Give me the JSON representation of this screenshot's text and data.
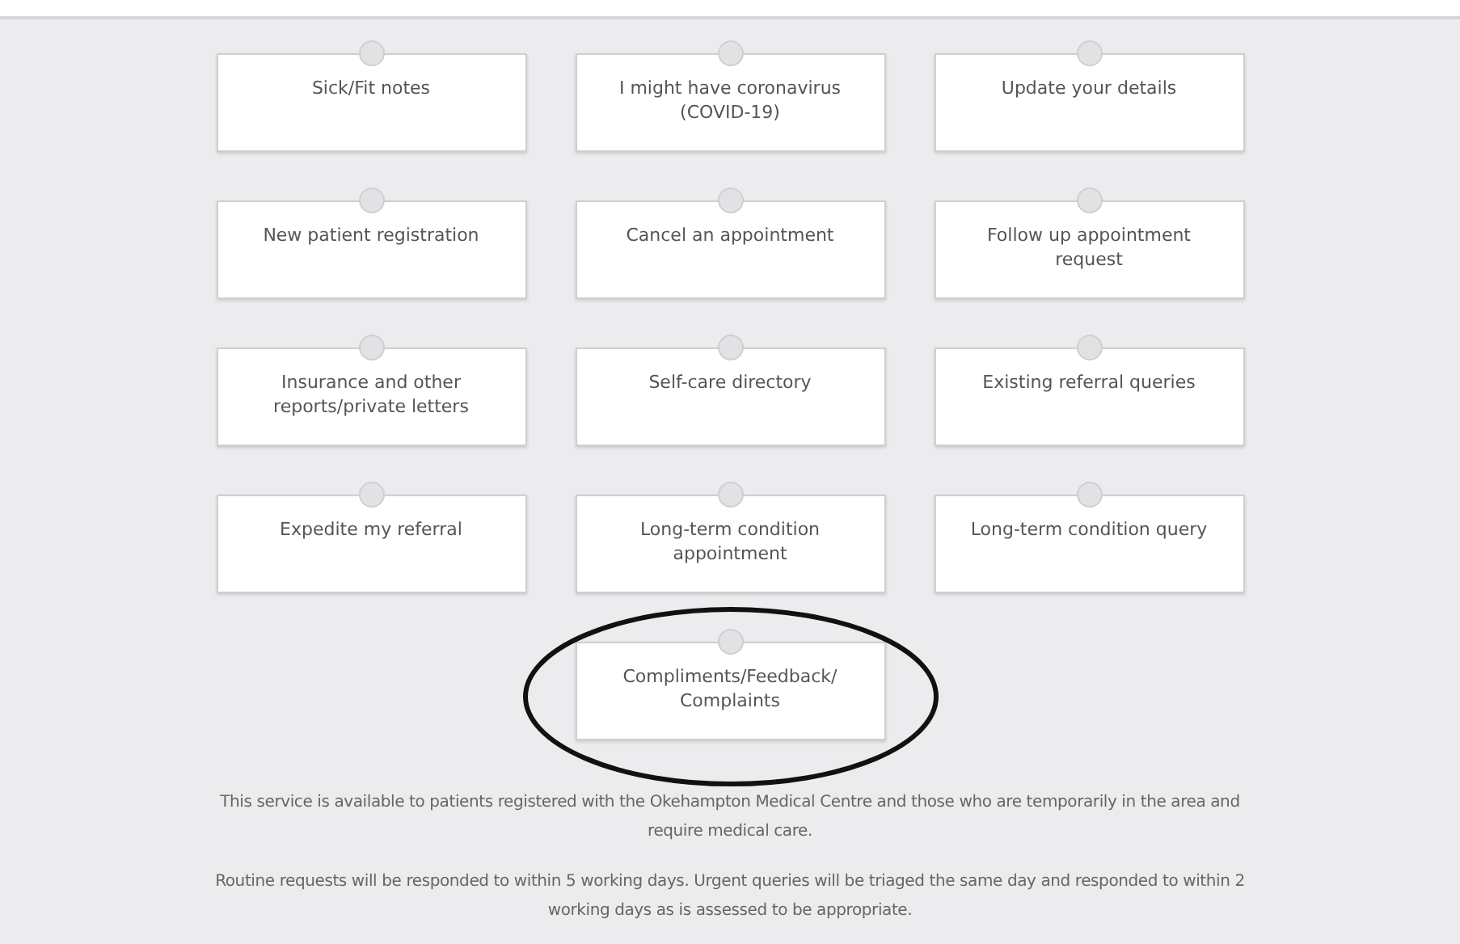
{
  "tiles": [
    {
      "label": "Sick/Fit notes",
      "circled": false
    },
    {
      "label": "I might have coronavirus (COVID-19)",
      "circled": false
    },
    {
      "label": "Update your details",
      "circled": false
    },
    {
      "label": "New patient registration",
      "circled": false
    },
    {
      "label": "Cancel an appointment",
      "circled": false
    },
    {
      "label": "Follow up appointment request",
      "circled": false
    },
    {
      "label": "Insurance and other reports/private letters",
      "circled": false
    },
    {
      "label": "Self-care directory",
      "circled": false
    },
    {
      "label": "Existing referral queries",
      "circled": false
    },
    {
      "label": "Expedite my referral",
      "circled": false
    },
    {
      "label": "Long-term condition appointment",
      "circled": false
    },
    {
      "label": "Long-term condition query",
      "circled": false
    },
    {
      "label": "Compliments/Feedback/ Complaints",
      "circled": true
    }
  ],
  "notes": [
    "This service is available to patients registered with the Okehampton Medical Centre and those who are temporarily in the area and require medical care.",
    "Routine requests will be responded to within 5 working days. Urgent queries will be triaged the same day and responded to within 2 working days as is assessed to be appropriate."
  ]
}
